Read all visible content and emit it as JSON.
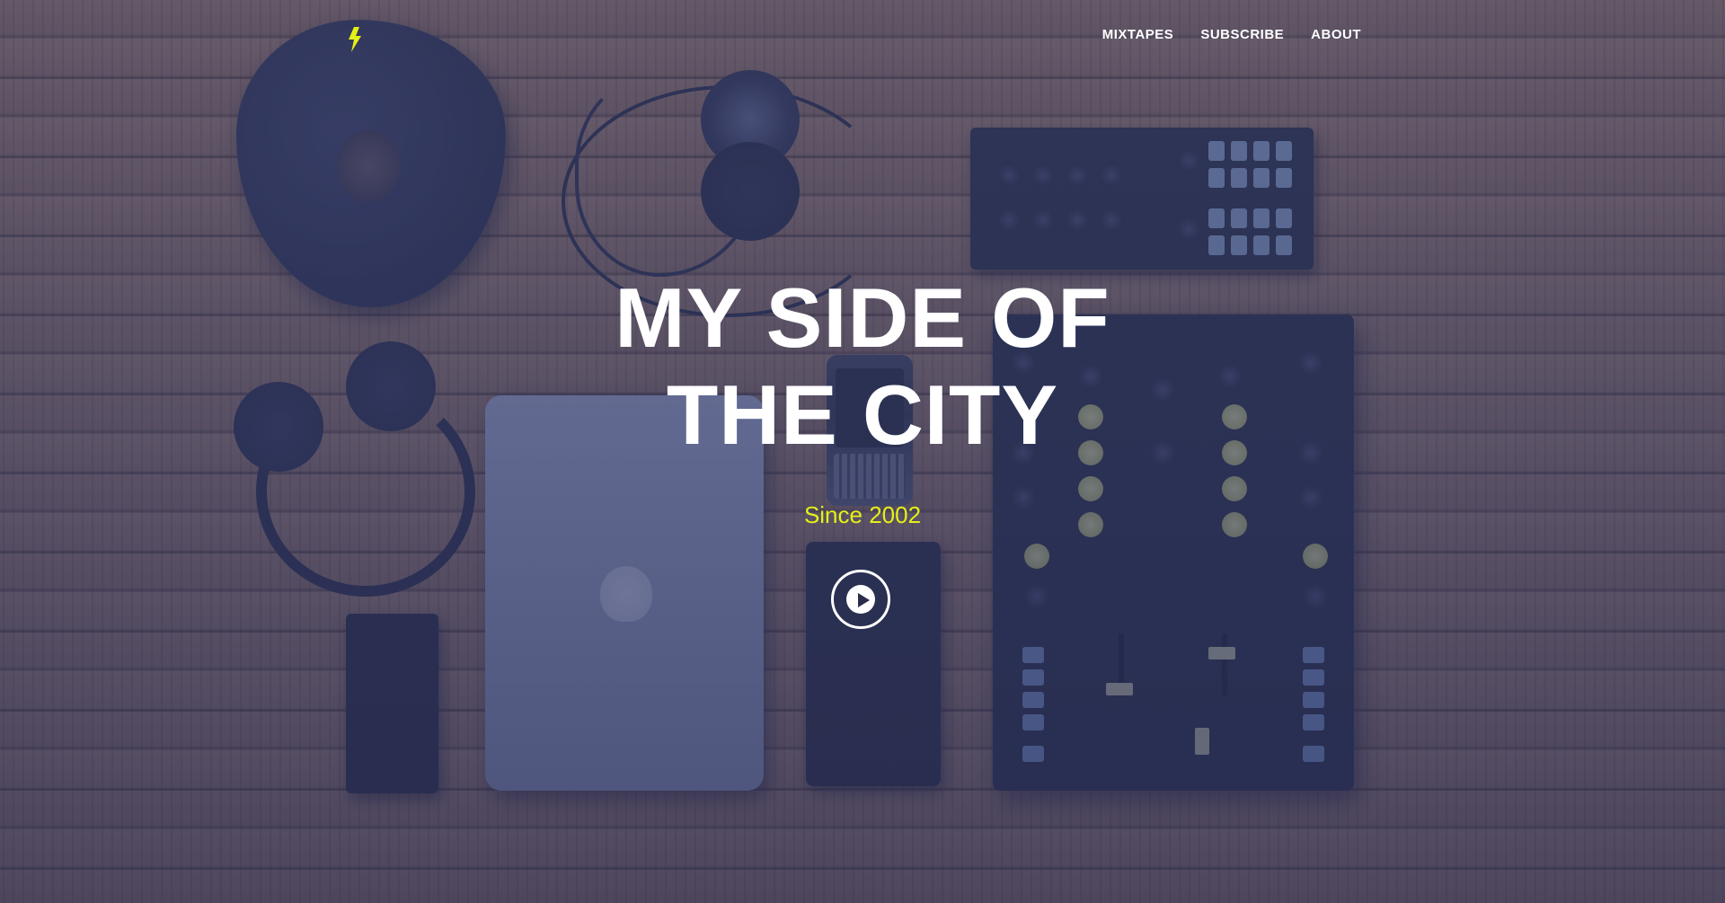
{
  "nav": {
    "items": [
      {
        "label": "MIXTAPES"
      },
      {
        "label": "SUBSCRIBE"
      },
      {
        "label": "ABOUT"
      }
    ]
  },
  "logo": {
    "icon": "lightning-bolt-icon",
    "color": "#e4f016"
  },
  "hero": {
    "title_line1": "MY SIDE OF",
    "title_line2": "THE CITY",
    "subtitle": "Since 2002",
    "play_icon": "play-circle-icon"
  },
  "colors": {
    "accent": "#e4f016",
    "overlay": "#3a426e",
    "text": "#ffffff"
  }
}
